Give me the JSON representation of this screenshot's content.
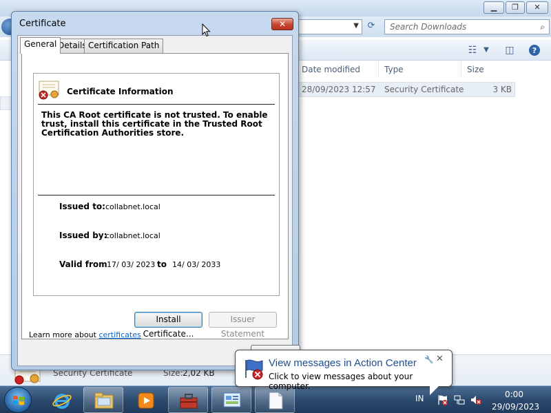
{
  "explorer": {
    "search_placeholder": "Search Downloads",
    "columns": [
      "Date modified",
      "Type",
      "Size"
    ],
    "file_row": {
      "date": "28/09/2023 12:57",
      "type": "Security Certificate",
      "size": "3 KB"
    },
    "details": {
      "type": "Security Certificate",
      "size_label": "Size:",
      "size_value": "2,02 KB"
    },
    "controls": {
      "minimize": "▁",
      "maximize": "❐",
      "close": "✕"
    }
  },
  "dialog": {
    "title": "Certificate",
    "close_label": "✕",
    "tabs": [
      "General",
      "Details",
      "Certification Path"
    ],
    "info_title": "Certificate Information",
    "warning": "This CA Root certificate is not trusted. To enable trust, install this certificate in the Trusted Root Certification Authorities store.",
    "issued_to_label": "Issued to:",
    "issued_to": "collabnet.local",
    "issued_by_label": "Issued by:",
    "issued_by": "collabnet.local",
    "valid_from_label": "Valid from",
    "valid_from": "17/ 03/ 2023",
    "valid_to_label": "to",
    "valid_to": "14/ 03/ 2033",
    "install_button": "Install Certificate...",
    "issuer_button": "Issuer Statement",
    "learn_more_prefix": "Learn more about ",
    "learn_more_link": "certificates"
  },
  "balloon": {
    "title": "View messages in Action Center",
    "text": "Click to view messages about your computer.",
    "close_label": "✕",
    "wrench_label": "🔧"
  },
  "taskbar": {
    "language": "IN",
    "time": "0:00",
    "date": "29/09/2023"
  },
  "colors": {
    "link": "#0066cc",
    "balloon_title": "#1e4f91",
    "close_red": "#c7442f",
    "taskbar": "#2c4a6e"
  }
}
